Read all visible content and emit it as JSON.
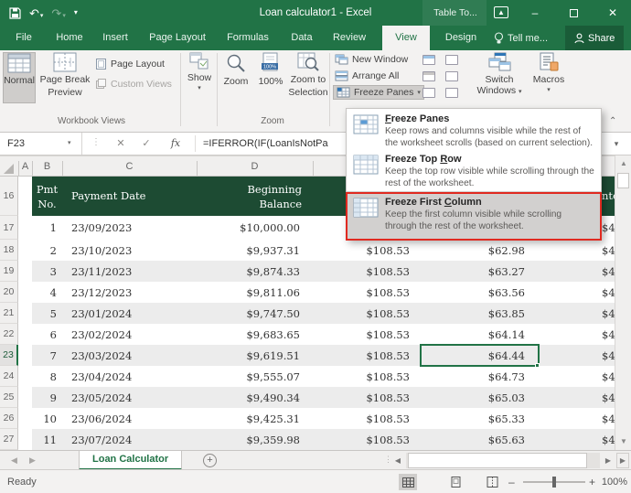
{
  "window": {
    "title": "Loan calculator1 - Excel",
    "contextual_tab": "Table To..."
  },
  "menu_tabs": [
    {
      "label": "File"
    },
    {
      "label": "Home"
    },
    {
      "label": "Insert"
    },
    {
      "label": "Page Layout"
    },
    {
      "label": "Formulas"
    },
    {
      "label": "Data"
    },
    {
      "label": "Review"
    },
    {
      "label": "View",
      "active": true
    },
    {
      "label": "Design"
    }
  ],
  "tell_me": "Tell me...",
  "share_label": "Share",
  "ribbon": {
    "workbook_views": {
      "group_label": "Workbook Views",
      "normal": "Normal",
      "page_break_line1": "Page Break",
      "page_break_line2": "Preview",
      "page_layout": "Page Layout",
      "custom_views": "Custom Views"
    },
    "show": {
      "label": "Show"
    },
    "zoom_group": {
      "group_label": "Zoom",
      "zoom": "Zoom",
      "hundred": "100%",
      "zoom_to_line1": "Zoom to",
      "zoom_to_line2": "Selection"
    },
    "window_group": {
      "new_window": "New Window",
      "arrange_all": "Arrange All",
      "freeze_panes": "Freeze Panes",
      "switch_line1": "Switch",
      "switch_line2": "Windows",
      "macros": "Macros"
    }
  },
  "freeze_menu": {
    "items": [
      {
        "title_pre": "",
        "title_u": "F",
        "title_post": "reeze Panes",
        "desc": "Keep rows and columns visible while the rest of the worksheet scrolls (based on current selection).",
        "highlighted": false
      },
      {
        "title_pre": "Freeze Top ",
        "title_u": "R",
        "title_post": "ow",
        "desc": "Keep the top row visible while scrolling through the rest of the worksheet.",
        "highlighted": false
      },
      {
        "title_pre": "Freeze First ",
        "title_u": "C",
        "title_post": "olumn",
        "desc": "Keep the first column visible while scrolling through the rest of the worksheet.",
        "highlighted": true
      }
    ]
  },
  "formula_bar": {
    "name_box": "F23",
    "formula": "=IFERROR(IF(LoanIsNotPa"
  },
  "sheet": {
    "column_letters": [
      "A",
      "B",
      "C",
      "D"
    ],
    "table_header": {
      "row_number": "16",
      "pmt_line1": "Pmt",
      "pmt_line2": "No.",
      "date": "Payment Date",
      "balance_line1": "Beginning",
      "balance_line2": "Balance",
      "right_fragment": "nte"
    },
    "selected_cell_ref": "F23",
    "rows": [
      {
        "row_number": "17",
        "pmt": "1",
        "date": "23/09/2023",
        "balance": "$10,000.00",
        "payment": "",
        "principal": "",
        "interest_fragment": "$4",
        "shaded": false,
        "selected": false
      },
      {
        "row_number": "18",
        "pmt": "2",
        "date": "23/10/2023",
        "balance": "$9,937.31",
        "payment": "$108.53",
        "principal": "$62.98",
        "interest_fragment": "$4",
        "shaded": false,
        "selected": false
      },
      {
        "row_number": "19",
        "pmt": "3",
        "date": "23/11/2023",
        "balance": "$9,874.33",
        "payment": "$108.53",
        "principal": "$63.27",
        "interest_fragment": "$4",
        "shaded": true,
        "selected": false
      },
      {
        "row_number": "20",
        "pmt": "4",
        "date": "23/12/2023",
        "balance": "$9,811.06",
        "payment": "$108.53",
        "principal": "$63.56",
        "interest_fragment": "$4",
        "shaded": false,
        "selected": false
      },
      {
        "row_number": "21",
        "pmt": "5",
        "date": "23/01/2024",
        "balance": "$9,747.50",
        "payment": "$108.53",
        "principal": "$63.85",
        "interest_fragment": "$4",
        "shaded": true,
        "selected": false
      },
      {
        "row_number": "22",
        "pmt": "6",
        "date": "23/02/2024",
        "balance": "$9,683.65",
        "payment": "$108.53",
        "principal": "$64.14",
        "interest_fragment": "$4",
        "shaded": false,
        "selected": false
      },
      {
        "row_number": "23",
        "pmt": "7",
        "date": "23/03/2024",
        "balance": "$9,619.51",
        "payment": "$108.53",
        "principal": "$64.44",
        "interest_fragment": "$4",
        "shaded": true,
        "selected": true
      },
      {
        "row_number": "24",
        "pmt": "8",
        "date": "23/04/2024",
        "balance": "$9,555.07",
        "payment": "$108.53",
        "principal": "$64.73",
        "interest_fragment": "$4",
        "shaded": false,
        "selected": false
      },
      {
        "row_number": "25",
        "pmt": "9",
        "date": "23/05/2024",
        "balance": "$9,490.34",
        "payment": "$108.53",
        "principal": "$65.03",
        "interest_fragment": "$4",
        "shaded": true,
        "selected": false
      },
      {
        "row_number": "26",
        "pmt": "10",
        "date": "23/06/2024",
        "balance": "$9,425.31",
        "payment": "$108.53",
        "principal": "$65.33",
        "interest_fragment": "$4",
        "shaded": false,
        "selected": false
      },
      {
        "row_number": "27",
        "pmt": "11",
        "date": "23/07/2024",
        "balance": "$9,359.98",
        "payment": "$108.53",
        "principal": "$65.63",
        "interest_fragment": "$4",
        "shaded": true,
        "selected": false
      }
    ]
  },
  "sheet_tab_bar": {
    "active_tab": "Loan Calculator"
  },
  "status_bar": {
    "mode": "Ready",
    "zoom_level": "100%"
  },
  "colors": {
    "excel_green": "#217346",
    "table_header_green": "#1d4b33",
    "highlight_red": "#e02920",
    "band_gray": "#ececec"
  }
}
